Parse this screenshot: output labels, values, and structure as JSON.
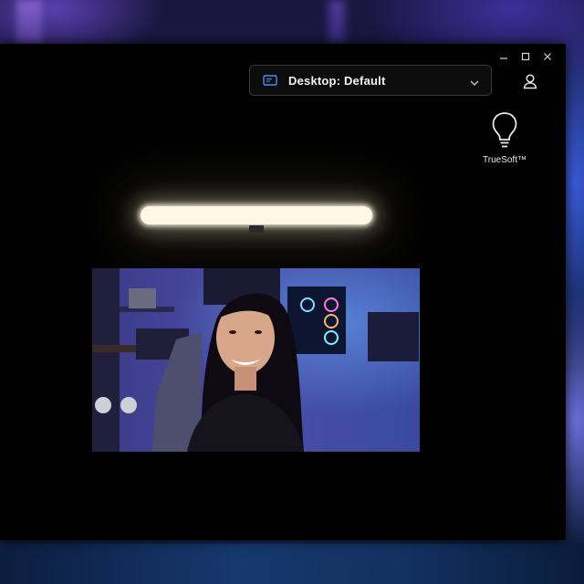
{
  "window": {
    "controls": {
      "minimize": "minimize-icon",
      "maximize": "maximize-icon",
      "close": "close-icon"
    }
  },
  "profile": {
    "label": "Desktop: Default",
    "icon": "monitor-icon"
  },
  "account": {
    "icon": "user-icon"
  },
  "truesoft": {
    "label": "TrueSoft™",
    "icon": "lightbulb-icon"
  },
  "colors": {
    "app_background": "#000000",
    "light_bar": "#fff8e6",
    "profile_icon_accent": "#4a8cff"
  }
}
